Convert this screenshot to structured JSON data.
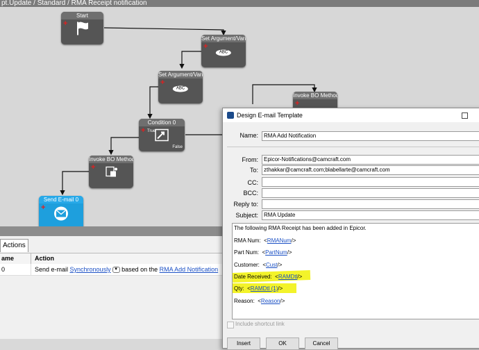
{
  "window": {
    "title": "pt.Update / Standard / RMA Receipt notification"
  },
  "workflow": {
    "nodes": {
      "start": {
        "title": "Start"
      },
      "set_arg_1": {
        "title": "Set Argument/Vari",
        "icon_text": "ABC"
      },
      "set_arg_2": {
        "title": "Set Argument/Vari",
        "icon_text": "ABC"
      },
      "condition": {
        "title": "Condition 0",
        "true_label": "True",
        "false_label": "False"
      },
      "invoke_bo_1": {
        "title": "Invoke BO Method"
      },
      "invoke_bo_2": {
        "title": "Invoke BO Method"
      },
      "send_email": {
        "title": "Send E-mail 0"
      }
    }
  },
  "actions_panel": {
    "tab_label": "Actions",
    "columns": [
      "ame",
      "Action"
    ],
    "row": {
      "col1": "0",
      "text_prefix": "Send e-mail ",
      "mode_link": "Synchronously",
      "text_mid": " based on the ",
      "template_link": "RMA Add Notification"
    }
  },
  "dialog": {
    "title": "Design E-mail Template",
    "name_label": "Name:",
    "name_value": "RMA Add Notification",
    "from_label": "From:",
    "from_value": "Epicor-Notifications@camcraft.com",
    "to_label": "To:",
    "to_value": "zthakkar@camcraft.com;blabellarte@camcraft.com",
    "cc_label": "CC:",
    "cc_value": "",
    "bcc_label": "BCC:",
    "bcc_value": "",
    "replyto_label": "Reply to:",
    "replyto_value": "",
    "subject_label": "Subject:",
    "subject_value": "RMA Update",
    "body": {
      "intro": "The following RMA Receipt has been added in Epicor.",
      "lines": [
        {
          "label": "RMA Num:",
          "field": "RMANum"
        },
        {
          "label": "Part Num:",
          "field": "PartNum"
        },
        {
          "label": "Customer:",
          "field": "Cust"
        },
        {
          "label": "Date Received:",
          "field": "RAMDtl"
        },
        {
          "label": "Qty:",
          "field": "RAMDtl (1)"
        },
        {
          "label": "Reason:",
          "field": "Reason"
        }
      ],
      "open_bracket": "<",
      "close_bracket": "/>"
    },
    "shortcut_label": "Include shortcut link",
    "buttons": {
      "insert": "Insert",
      "ok": "OK",
      "cancel": "Cancel"
    }
  },
  "colors": {
    "highlight": "#f3f32a",
    "link": "#1a4fc4",
    "node": "#555555",
    "send_node": "#1e9fdd"
  }
}
